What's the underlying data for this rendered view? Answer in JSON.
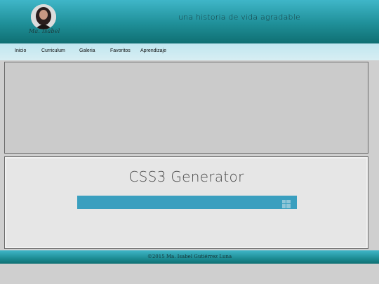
{
  "header": {
    "author_signature": "Ma. Isabel",
    "tagline": "una historia de vida agradable"
  },
  "nav": {
    "items": [
      {
        "label": "Inicio"
      },
      {
        "label": "Curriculum"
      },
      {
        "label": "Galeria"
      },
      {
        "label": "Favoritos"
      },
      {
        "label": "Aprendizaje"
      }
    ]
  },
  "main": {
    "generator_title": "CSS3 Generator"
  },
  "footer": {
    "copyright": "©2015 Ma. Isabel Gutiérrez Luna"
  },
  "colors": {
    "header_teal": "#1f8f98",
    "nav_light": "#cde9f1",
    "generator_bar": "#3a9fbf",
    "page_bg": "#cfcfcf"
  },
  "icons": {
    "grid": "grid-icon"
  }
}
